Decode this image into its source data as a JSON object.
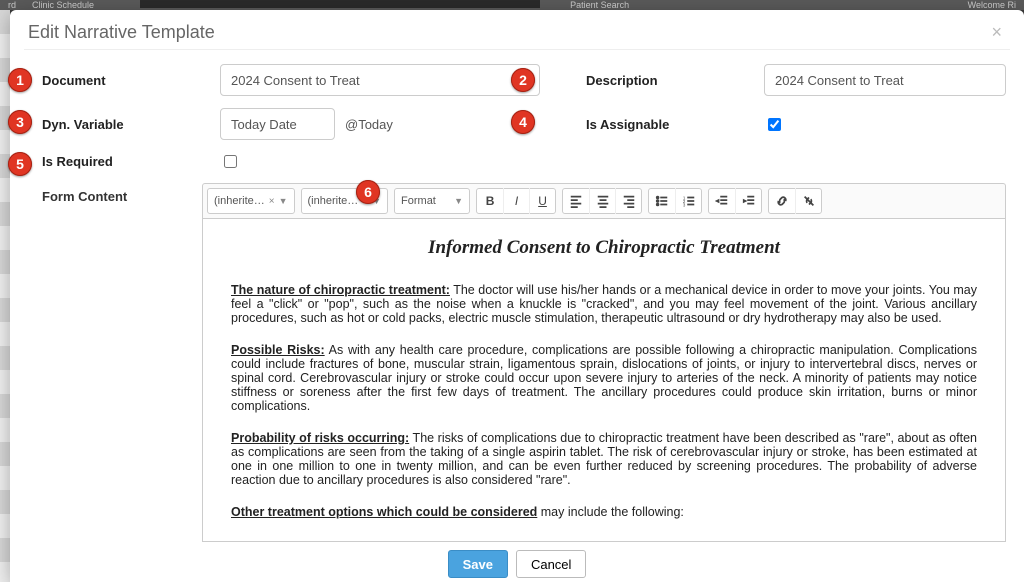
{
  "bg": {
    "menu1": "Clinic Schedule",
    "menu2": "Patient Search",
    "welcome": "Welcome Ri"
  },
  "modal": {
    "title": "Edit Narrative Template",
    "close": "×"
  },
  "labels": {
    "document": "Document",
    "description": "Description",
    "dynvar": "Dyn. Variable",
    "isassignable": "Is Assignable",
    "isrequired": "Is Required",
    "formcontent": "Form Content"
  },
  "values": {
    "document": "2024 Consent to Treat",
    "description": "2024 Consent to Treat",
    "dynvar": "Today Date",
    "dynvar_tag": "@Today",
    "isassignable": true,
    "isrequired": false
  },
  "toolbar": {
    "font1": "(inherite…",
    "font2": "(inherite…",
    "format": "Format",
    "clear": "×",
    "chev": "▼"
  },
  "editor": {
    "title": "Informed Consent to Chiropractic Treatment",
    "p1_lead": "The nature of chiropractic treatment:",
    "p1": " The doctor will use his/her hands or a mechanical device in order to move your joints. You may feel a \"click\" or \"pop\", such as the noise when a knuckle is \"cracked\", and you may feel movement of the joint. Various ancillary procedures, such as hot or cold packs, electric muscle stimulation, therapeutic ultrasound or dry hydrotherapy may also be used.",
    "p2_lead": "Possible Risks:",
    "p2": " As with any health care procedure, complications are possible following a chiropractic manipulation. Complications could include fractures of bone, muscular strain, ligamentous sprain, dislocations of joints, or injury to intervertebral discs, nerves or spinal cord. Cerebrovascular injury or stroke could occur upon severe injury to arteries of the neck. A minority of patients may notice stiffness or soreness after the first few days of treatment. The ancillary procedures could produce skin irritation, burns or minor complications.",
    "p3_lead": "Probability of risks occurring:",
    "p3": " The risks of complications due to chiropractic treatment have been described as \"rare\", about as often as complications are seen from the taking of a single aspirin tablet. The risk of cerebrovascular injury or stroke, has been estimated at one in one million to one in twenty million, and can be even further reduced by screening procedures. The probability of adverse reaction due to ancillary procedures is also considered \"rare\".",
    "p4_lead": "Other treatment options which could be considered",
    "p4": " may include the following:"
  },
  "footer": {
    "save": "Save",
    "cancel": "Cancel"
  },
  "badges": {
    "b1": "1",
    "b2": "2",
    "b3": "3",
    "b4": "4",
    "b5": "5",
    "b6": "6"
  }
}
